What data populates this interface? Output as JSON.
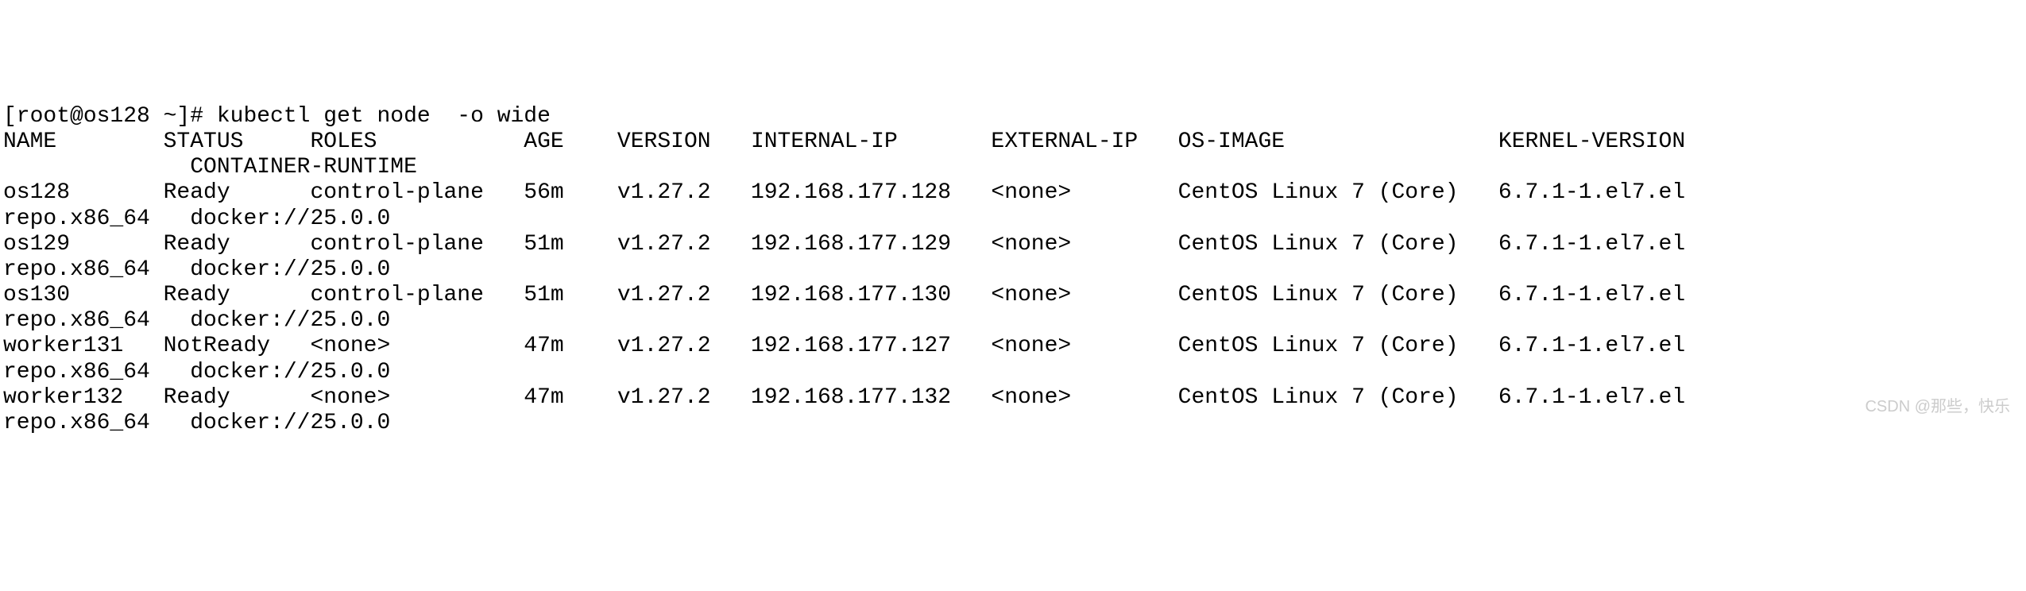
{
  "prompt": "[root@os128 ~]# ",
  "command": "kubectl get node  -o wide",
  "header": {
    "name": "NAME",
    "status": "STATUS",
    "roles": "ROLES",
    "age": "AGE",
    "version": "VERSION",
    "internal_ip": "INTERNAL-IP",
    "external_ip": "EXTERNAL-IP",
    "os_image": "OS-IMAGE",
    "kernel_version": "KERNEL-VERSION",
    "container_runtime": "CONTAINER-RUNTIME"
  },
  "rows": [
    {
      "name": "os128",
      "status": "Ready",
      "roles": "control-plane",
      "age": "56m",
      "version": "v1.27.2",
      "internal_ip": "192.168.177.128",
      "external_ip": "<none>",
      "os_image": "CentOS Linux 7 (Core)",
      "kernel_version": "6.7.1-1.el7.el",
      "wrap_prefix": "repo.x86_64",
      "container_runtime": "docker://25.0.0"
    },
    {
      "name": "os129",
      "status": "Ready",
      "roles": "control-plane",
      "age": "51m",
      "version": "v1.27.2",
      "internal_ip": "192.168.177.129",
      "external_ip": "<none>",
      "os_image": "CentOS Linux 7 (Core)",
      "kernel_version": "6.7.1-1.el7.el",
      "wrap_prefix": "repo.x86_64",
      "container_runtime": "docker://25.0.0"
    },
    {
      "name": "os130",
      "status": "Ready",
      "roles": "control-plane",
      "age": "51m",
      "version": "v1.27.2",
      "internal_ip": "192.168.177.130",
      "external_ip": "<none>",
      "os_image": "CentOS Linux 7 (Core)",
      "kernel_version": "6.7.1-1.el7.el",
      "wrap_prefix": "repo.x86_64",
      "container_runtime": "docker://25.0.0"
    },
    {
      "name": "worker131",
      "status": "NotReady",
      "roles": "<none>",
      "age": "47m",
      "version": "v1.27.2",
      "internal_ip": "192.168.177.127",
      "external_ip": "<none>",
      "os_image": "CentOS Linux 7 (Core)",
      "kernel_version": "6.7.1-1.el7.el",
      "wrap_prefix": "repo.x86_64",
      "container_runtime": "docker://25.0.0"
    },
    {
      "name": "worker132",
      "status": "Ready",
      "roles": "<none>",
      "age": "47m",
      "version": "v1.27.2",
      "internal_ip": "192.168.177.132",
      "external_ip": "<none>",
      "os_image": "CentOS Linux 7 (Core)",
      "kernel_version": "6.7.1-1.el7.el",
      "wrap_prefix": "repo.x86_64",
      "container_runtime": "docker://25.0.0"
    }
  ],
  "watermark": "CSDN @那些，快乐"
}
